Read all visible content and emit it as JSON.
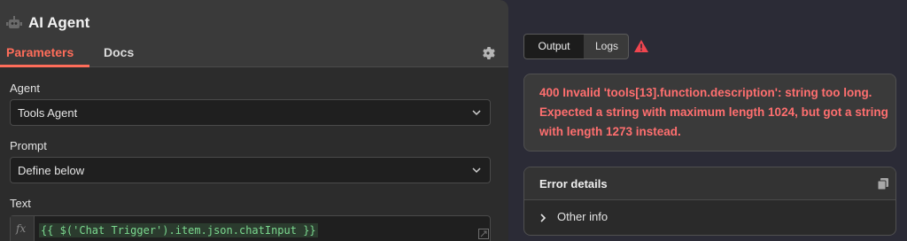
{
  "node": {
    "title": "AI Agent",
    "icon": "robot-icon",
    "tabs": [
      "Parameters",
      "Docs"
    ],
    "active_tab": "Parameters",
    "accent_color": "#ff6d5a"
  },
  "params": {
    "agent_label": "Agent",
    "agent_value": "Tools Agent",
    "prompt_label": "Prompt",
    "prompt_value": "Define below",
    "text_label": "Text",
    "text_fx": "fx",
    "text_expression": "{{ $('Chat Trigger').item.json.chatInput }}"
  },
  "output": {
    "tabs": [
      "Output",
      "Logs"
    ],
    "active_tab": "Output",
    "error_message": "400 Invalid 'tools[13].function.description': string too long. Expected a string with maximum length 1024, but got a string with length 1273 instead.",
    "error_color": "#ff6f6f",
    "details_title": "Error details",
    "other_info_label": "Other info"
  }
}
